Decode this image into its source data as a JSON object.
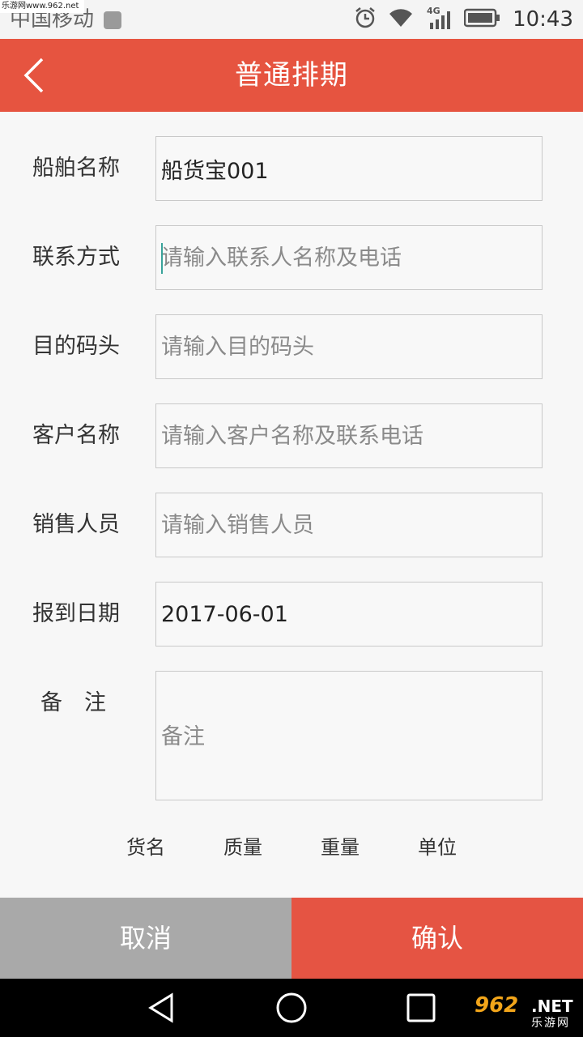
{
  "status_bar": {
    "carrier": "中国移动",
    "network": "4G",
    "time": "10:43",
    "watermark": "乐游网www.962.net"
  },
  "header": {
    "title": "普通排期",
    "back_icon": "chevron-left-icon",
    "background_color": "#e65440"
  },
  "form": {
    "fields": [
      {
        "label": "船舶名称",
        "value": "船货宝001",
        "placeholder": ""
      },
      {
        "label": "联系方式",
        "value": "",
        "placeholder": "请输入联系人名称及电话"
      },
      {
        "label": "目的码头",
        "value": "",
        "placeholder": "请输入目的码头"
      },
      {
        "label": "客户名称",
        "value": "",
        "placeholder": "请输入客户名称及联系电话"
      },
      {
        "label": "销售人员",
        "value": "",
        "placeholder": "请输入销售人员"
      },
      {
        "label": "报到日期",
        "value": "2017-06-01",
        "placeholder": ""
      }
    ],
    "remark": {
      "label": "备　注",
      "value": "",
      "placeholder": "备注"
    }
  },
  "goods_table": {
    "columns": [
      "货名",
      "质量",
      "重量",
      "单位"
    ]
  },
  "actions": {
    "cancel_label": "取消",
    "confirm_label": "确认",
    "cancel_color": "#a9a9a9",
    "confirm_color": "#e55443"
  },
  "nav_bar": {
    "back_icon": "triangle-back-icon",
    "home_icon": "circle-home-icon",
    "recents_icon": "square-recents-icon",
    "watermark_num": "962",
    "watermark_net": ".NET",
    "watermark_sub": "乐游网"
  }
}
